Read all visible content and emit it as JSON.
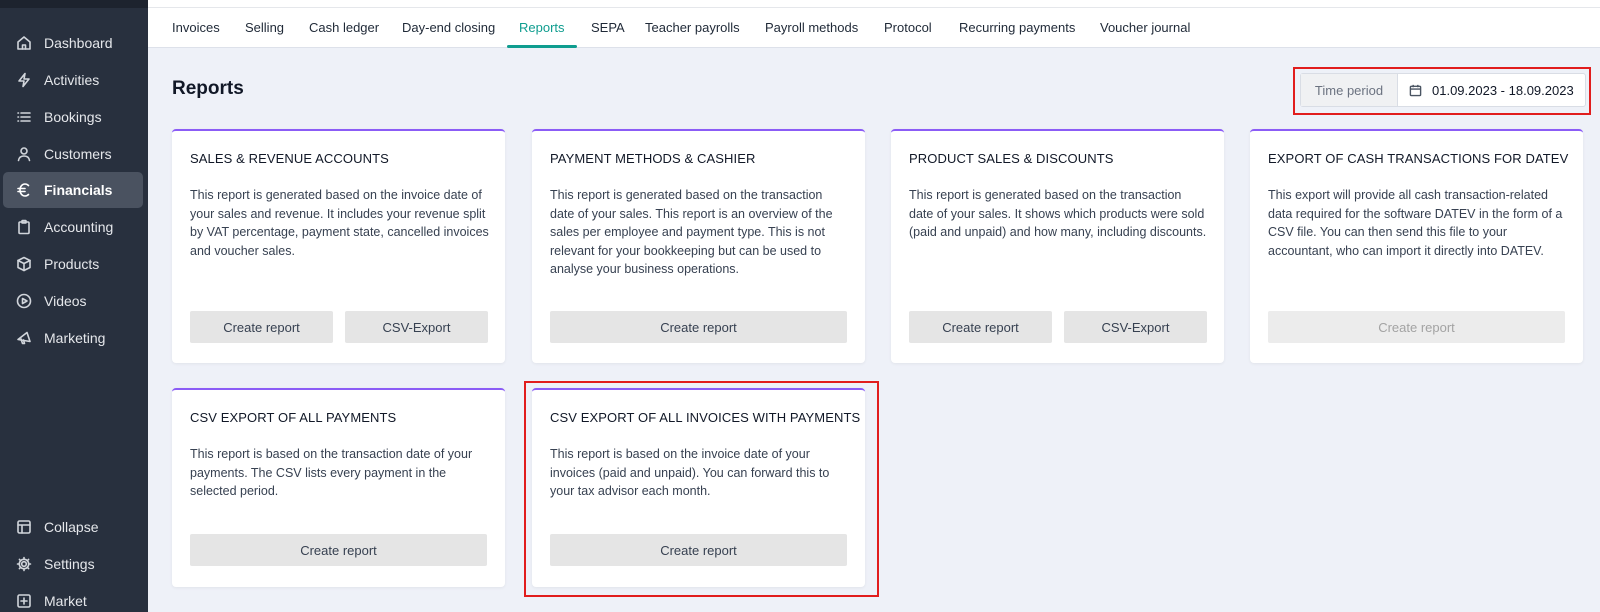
{
  "sidebar": {
    "items": [
      {
        "label": "Dashboard",
        "icon": "home-icon"
      },
      {
        "label": "Activities",
        "icon": "lightning-icon"
      },
      {
        "label": "Bookings",
        "icon": "list-icon"
      },
      {
        "label": "Customers",
        "icon": "user-icon"
      },
      {
        "label": "Financials",
        "icon": "euro-icon",
        "active": true
      },
      {
        "label": "Accounting",
        "icon": "clipboard-icon"
      },
      {
        "label": "Products",
        "icon": "box-icon"
      },
      {
        "label": "Videos",
        "icon": "play-icon"
      },
      {
        "label": "Marketing",
        "icon": "megaphone-icon"
      }
    ],
    "bottom": [
      {
        "label": "Collapse",
        "icon": "collapse-icon"
      },
      {
        "label": "Settings",
        "icon": "gear-icon"
      },
      {
        "label": "Market",
        "icon": "plus-square-icon"
      }
    ]
  },
  "tabs": [
    "Invoices",
    "Selling",
    "Cash ledger",
    "Day-end closing",
    "Reports",
    "SEPA",
    "Teacher payrolls",
    "Payroll methods",
    "Protocol",
    "Recurring payments",
    "Voucher journal"
  ],
  "active_tab": "Reports",
  "page": {
    "title": "Reports",
    "time_period_label": "Time period",
    "time_period_value": "01.09.2023 - 18.09.2023"
  },
  "cards": [
    {
      "title": "SALES & REVENUE ACCOUNTS",
      "description": "This report is generated based on the invoice date of your sales and revenue. It includes your revenue split by VAT percentage, payment state, cancelled invoices and voucher sales.",
      "buttons": [
        "Create report",
        "CSV-Export"
      ]
    },
    {
      "title": "PAYMENT METHODS & CASHIER",
      "description": "This report is generated based on the transaction date of your sales. This report is an overview of the sales per employee and payment type. This is not relevant for your bookkeeping but can be used to analyse your business operations.",
      "buttons": [
        "Create report"
      ]
    },
    {
      "title": "PRODUCT SALES & DISCOUNTS",
      "description": "This report is generated based on the transaction date of your sales. It shows which products were sold (paid and unpaid) and how many, including discounts.",
      "buttons": [
        "Create report",
        "CSV-Export"
      ]
    },
    {
      "title": "EXPORT OF CASH TRANSACTIONS FOR DATEV",
      "description": "This export will provide all cash transaction-related data required for the software DATEV in the form of a CSV file. You can then send this file to your accountant, who can import it directly into DATEV.",
      "buttons": [
        "Create report"
      ],
      "disabled": true
    },
    {
      "title": "CSV EXPORT OF ALL PAYMENTS",
      "description": "This report is based on the transaction date of your payments. The CSV lists every payment in the selected period.",
      "buttons": [
        "Create report"
      ]
    },
    {
      "title": "CSV EXPORT OF ALL INVOICES WITH PAYMENTS",
      "description": "This report is based on the invoice date of your invoices (paid and unpaid). You can forward this to your tax advisor each month.",
      "buttons": [
        "Create report"
      ],
      "highlighted": true
    }
  ],
  "colors": {
    "sidebar_bg": "#28303e",
    "accent_teal": "#0f9d8f",
    "card_border_purple": "#8b5cf6",
    "highlight_red": "#e11d1d"
  }
}
